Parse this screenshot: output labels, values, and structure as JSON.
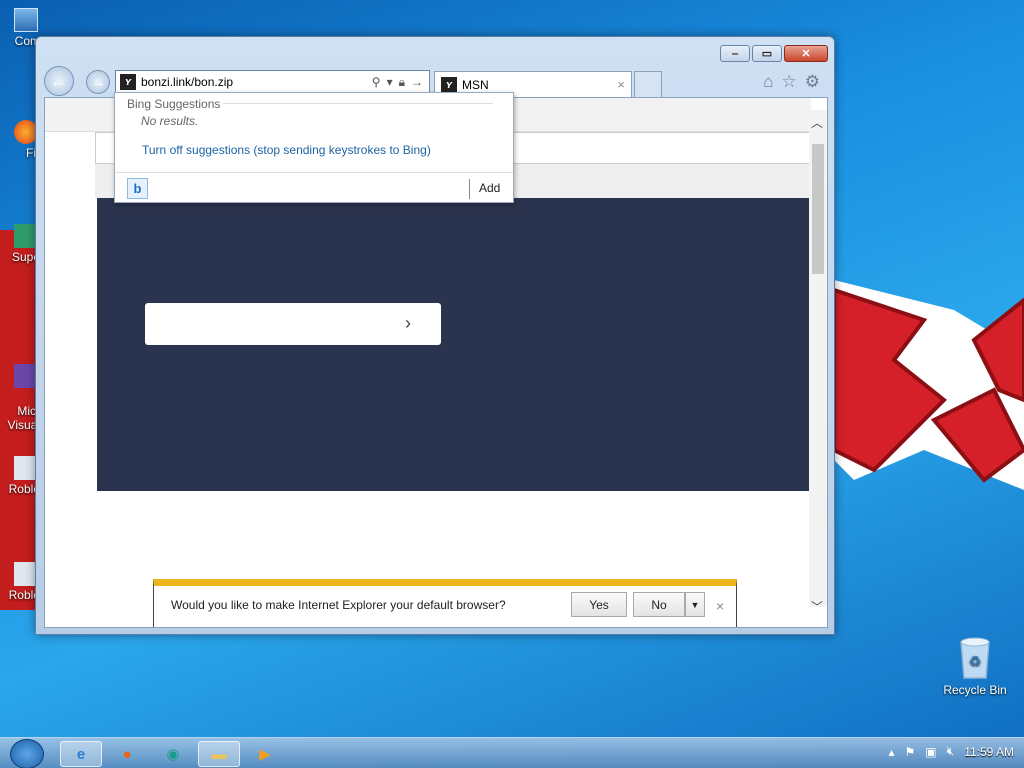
{
  "desktop": {
    "icons": [
      {
        "name": "Com",
        "icon": "computer-icon"
      },
      {
        "name": "Fir",
        "icon": "firefox-shortcut-icon"
      },
      {
        "name": "Supe",
        "icon": "app-shortcut-icon"
      },
      {
        "name": "Micr\nVisual",
        "icon": "app-shortcut-icon"
      },
      {
        "name": "Roblo",
        "icon": "roblox-shortcut-icon"
      },
      {
        "name": "Roblo",
        "icon": "roblox-shortcut-icon"
      }
    ],
    "recycle_bin": "Recycle Bin"
  },
  "browser": {
    "address_value": "bonzi.link/bon.zip",
    "tab_label": "MSN",
    "tab_close": "×",
    "caption": {
      "minimize": "‒",
      "maximize": "▭",
      "close": "✕"
    },
    "toolbar_icons": [
      "home-icon",
      "favorites-star-icon",
      "settings-gear-icon"
    ]
  },
  "suggestions": {
    "header": "Bing Suggestions",
    "no_results": "No results.",
    "turn_off_link": "Turn off suggestions (stop sending keystrokes to Bing)",
    "bing_button": "b",
    "add_label": "Add"
  },
  "notification": {
    "message": "Would you like to make Internet Explorer your default browser?",
    "yes_label": "Yes",
    "no_label": "No",
    "close": "×"
  },
  "taskbar": {
    "clock": "11:59 AM",
    "items": [
      "internet-explorer-icon",
      "firefox-icon",
      "app-icon",
      "file-explorer-icon",
      "media-player-icon"
    ]
  }
}
